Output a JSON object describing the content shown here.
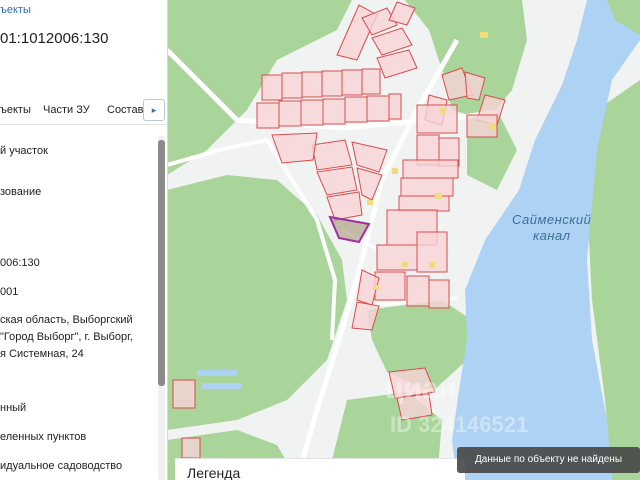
{
  "panel": {
    "breadcrumb": "ъекты",
    "cadastral_number": "01:1012006:130",
    "tabs": [
      {
        "label": "ъекты"
      },
      {
        "label": "Части ЗУ"
      },
      {
        "label": "Состав"
      }
    ],
    "tabs_arrow": "▸",
    "fields": [
      {
        "value": "й участок"
      },
      {
        "value": "зование"
      },
      {
        "value": "006:130"
      },
      {
        "value": "001"
      },
      {
        "value": "нный"
      },
      {
        "value": "еленных пунктов"
      },
      {
        "value": "идуальное садоводство"
      }
    ],
    "address": {
      "line1": "ская область, Выборгский",
      "line2": "\"Город Выборг\", г. Выборг,",
      "line3": "я Системная, 24"
    }
  },
  "map": {
    "water_label_line1": "Сайменский",
    "water_label_line2": "канал",
    "watermark": "циан",
    "watermark_id": "ID 324146521",
    "colors": {
      "forest": "#a9d59b",
      "open_land": "#f1f2f2",
      "water": "#aed2f3",
      "parcel_fill": "#f7d3d6",
      "parcel_stroke": "#d94c4c",
      "selected_parcel": "#a12ea7",
      "building": "#f1dc7a"
    }
  },
  "legend": {
    "label": "Легенда"
  },
  "toast": {
    "message": "Данные по объекту не найдены"
  }
}
